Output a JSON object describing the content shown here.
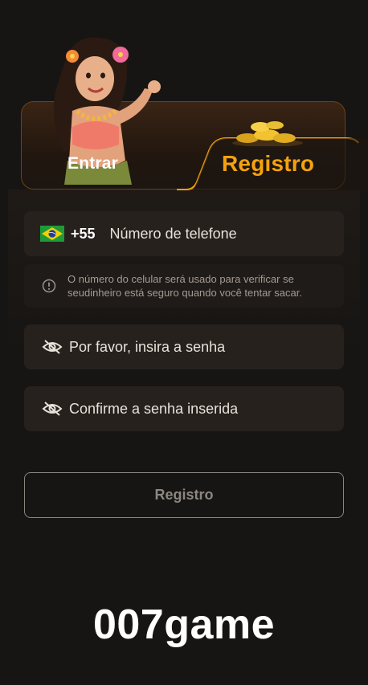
{
  "tabs": {
    "login_label": "Entrar",
    "register_label": "Registro"
  },
  "phone": {
    "country_flag": "brazil-flag-icon",
    "country_code": "+55",
    "placeholder": "Número de telefone"
  },
  "hint": {
    "icon": "info-icon",
    "text": "O número do celular será usado para verificar se seudinheiro está seguro quando você tentar sacar."
  },
  "password": {
    "icon": "eye-off-icon",
    "placeholder": "Por favor, insira a senha"
  },
  "confirm_password": {
    "icon": "eye-off-icon",
    "placeholder": "Confirme a senha inserida"
  },
  "submit": {
    "label": "Registro"
  },
  "brand": {
    "name": "007game"
  },
  "colors": {
    "background": "#171513",
    "accent": "#f5a20f",
    "field_bg": "#26211d",
    "hint_bg": "#1f1b18",
    "tab_border": "#6a4318"
  }
}
